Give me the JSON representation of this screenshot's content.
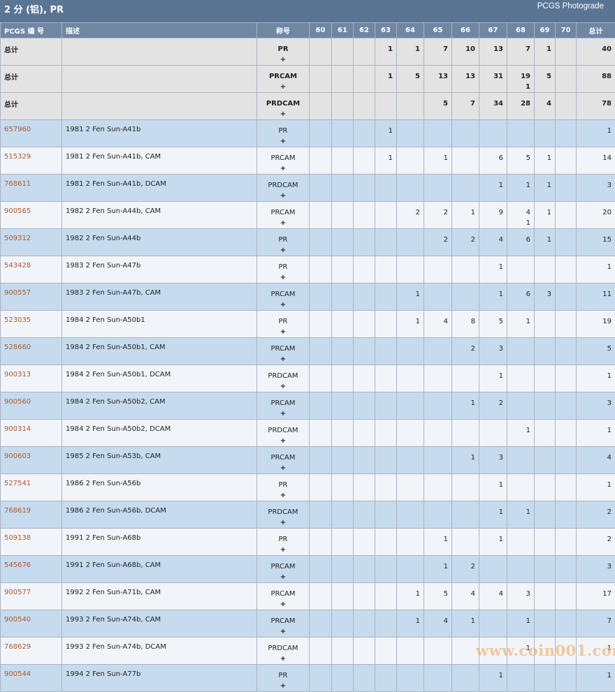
{
  "title": "2 分 (铝), PR",
  "brand": "PCGS Photograde",
  "headers": [
    "PCGS 编 号",
    "描述",
    "称号",
    "60",
    "61",
    "62",
    "63",
    "64",
    "65",
    "66",
    "67",
    "68",
    "69",
    "70",
    "总计"
  ],
  "rows": [
    {
      "type": "total",
      "id": "总计",
      "desc": "",
      "grade": [
        "PR",
        "+"
      ],
      "counts": [
        "",
        "",
        "",
        "1",
        "1",
        "7",
        "10",
        "13",
        "7",
        "1",
        "",
        "40"
      ]
    },
    {
      "type": "total",
      "id": "总计",
      "desc": "",
      "grade": [
        "PRCAM",
        "+"
      ],
      "counts": [
        "",
        "",
        "",
        "1",
        "5",
        "13",
        "13",
        "31",
        "19\n1",
        "5",
        "",
        "88"
      ]
    },
    {
      "type": "total",
      "id": "总计",
      "desc": "",
      "grade": [
        "PRDCAM",
        "+"
      ],
      "counts": [
        "",
        "",
        "",
        "",
        "",
        "5",
        "7",
        "34",
        "28",
        "4",
        "",
        "78"
      ]
    },
    {
      "type": "item",
      "id": "657960",
      "desc": "1981 2 Fen Sun-A41b",
      "grade": [
        "PR",
        "+"
      ],
      "counts": [
        "",
        "",
        "",
        "1",
        "",
        "",
        "",
        "",
        "",
        "",
        "",
        "1"
      ]
    },
    {
      "type": "item",
      "id": "515329",
      "desc": "1981 2 Fen Sun-A41b, CAM",
      "grade": [
        "PRCAM",
        "+"
      ],
      "counts": [
        "",
        "",
        "",
        "1",
        "",
        "1",
        "",
        "6",
        "5",
        "1",
        "",
        "14"
      ]
    },
    {
      "type": "item",
      "id": "768611",
      "desc": "1981 2 Fen Sun-A41b, DCAM",
      "grade": [
        "PRDCAM",
        "+"
      ],
      "counts": [
        "",
        "",
        "",
        "",
        "",
        "",
        "",
        "1",
        "1",
        "1",
        "",
        "3"
      ]
    },
    {
      "type": "item",
      "id": "900565",
      "desc": "1982 2 Fen Sun-A44b, CAM",
      "grade": [
        "PRCAM",
        "+"
      ],
      "counts": [
        "",
        "",
        "",
        "",
        "2",
        "2",
        "1",
        "9",
        "4\n1",
        "1",
        "",
        "20"
      ]
    },
    {
      "type": "item",
      "id": "509312",
      "desc": "1982 2 Fen Sun-A44b",
      "grade": [
        "PR",
        "+"
      ],
      "counts": [
        "",
        "",
        "",
        "",
        "",
        "2",
        "2",
        "4",
        "6",
        "1",
        "",
        "15"
      ]
    },
    {
      "type": "item",
      "id": "543428",
      "desc": "1983 2 Fen Sun-A47b",
      "grade": [
        "PR",
        "+"
      ],
      "counts": [
        "",
        "",
        "",
        "",
        "",
        "",
        "",
        "1",
        "",
        "",
        "",
        "1"
      ]
    },
    {
      "type": "item",
      "id": "900557",
      "desc": "1983 2 Fen Sun-A47b, CAM",
      "grade": [
        "PRCAM",
        "+"
      ],
      "counts": [
        "",
        "",
        "",
        "",
        "1",
        "",
        "",
        "1",
        "6",
        "3",
        "",
        "11"
      ]
    },
    {
      "type": "item",
      "id": "523035",
      "desc": "1984 2 Fen Sun-A50b1",
      "grade": [
        "PR",
        "+"
      ],
      "counts": [
        "",
        "",
        "",
        "",
        "1",
        "4",
        "8",
        "5",
        "1",
        "",
        "",
        "19"
      ]
    },
    {
      "type": "item",
      "id": "528660",
      "desc": "1984 2 Fen Sun-A50b1, CAM",
      "grade": [
        "PRCAM",
        "+"
      ],
      "counts": [
        "",
        "",
        "",
        "",
        "",
        "",
        "2",
        "3",
        "",
        "",
        "",
        "5"
      ]
    },
    {
      "type": "item",
      "id": "900313",
      "desc": "1984 2 Fen Sun-A50b1, DCAM",
      "grade": [
        "PRDCAM",
        "+"
      ],
      "counts": [
        "",
        "",
        "",
        "",
        "",
        "",
        "",
        "1",
        "",
        "",
        "",
        "1"
      ]
    },
    {
      "type": "item",
      "id": "900560",
      "desc": "1984 2 Fen Sun-A50b2, CAM",
      "grade": [
        "PRCAM",
        "+"
      ],
      "counts": [
        "",
        "",
        "",
        "",
        "",
        "",
        "1",
        "2",
        "",
        "",
        "",
        "3"
      ]
    },
    {
      "type": "item",
      "id": "900314",
      "desc": "1984 2 Fen Sun-A50b2, DCAM",
      "grade": [
        "PRDCAM",
        "+"
      ],
      "counts": [
        "",
        "",
        "",
        "",
        "",
        "",
        "",
        "",
        "1",
        "",
        "",
        "1"
      ]
    },
    {
      "type": "item",
      "id": "900603",
      "desc": "1985 2 Fen Sun-A53b, CAM",
      "grade": [
        "PRCAM",
        "+"
      ],
      "counts": [
        "",
        "",
        "",
        "",
        "",
        "",
        "1",
        "3",
        "",
        "",
        "",
        "4"
      ]
    },
    {
      "type": "item",
      "id": "527541",
      "desc": "1986 2 Fen Sun-A56b",
      "grade": [
        "PR",
        "+"
      ],
      "counts": [
        "",
        "",
        "",
        "",
        "",
        "",
        "",
        "1",
        "",
        "",
        "",
        "1"
      ]
    },
    {
      "type": "item",
      "id": "768619",
      "desc": "1986 2 Fen Sun-A56b, DCAM",
      "grade": [
        "PRDCAM",
        "+"
      ],
      "counts": [
        "",
        "",
        "",
        "",
        "",
        "",
        "",
        "1",
        "1",
        "",
        "",
        "2"
      ]
    },
    {
      "type": "item",
      "id": "509138",
      "desc": "1991 2 Fen Sun-A68b",
      "grade": [
        "PR",
        "+"
      ],
      "counts": [
        "",
        "",
        "",
        "",
        "",
        "1",
        "",
        "1",
        "",
        "",
        "",
        "2"
      ]
    },
    {
      "type": "item",
      "id": "545676",
      "desc": "1991 2 Fen Sun-A68b, CAM",
      "grade": [
        "PRCAM",
        "+"
      ],
      "counts": [
        "",
        "",
        "",
        "",
        "",
        "1",
        "2",
        "",
        "",
        "",
        "",
        "3"
      ]
    },
    {
      "type": "item",
      "id": "900577",
      "desc": "1992 2 Fen Sun-A71b, CAM",
      "grade": [
        "PRCAM",
        "+"
      ],
      "counts": [
        "",
        "",
        "",
        "",
        "1",
        "5",
        "4",
        "4",
        "3",
        "",
        "",
        "17"
      ]
    },
    {
      "type": "item",
      "id": "900540",
      "desc": "1993 2 Fen Sun-A74b, CAM",
      "grade": [
        "PRCAM",
        "+"
      ],
      "counts": [
        "",
        "",
        "",
        "",
        "1",
        "4",
        "1",
        "",
        "1",
        "",
        "",
        "7"
      ]
    },
    {
      "type": "item",
      "id": "768629",
      "desc": "1993 2 Fen Sun-A74b, DCAM",
      "grade": [
        "PRDCAM",
        "+"
      ],
      "counts": [
        "",
        "",
        "",
        "",
        "",
        "",
        "",
        "",
        "1",
        "",
        "",
        "1"
      ]
    },
    {
      "type": "item",
      "id": "900544",
      "desc": "1994 2 Fen Sun-A77b",
      "grade": [
        "PR",
        "+"
      ],
      "counts": [
        "",
        "",
        "",
        "",
        "",
        "",
        "",
        "1",
        "",
        "",
        "",
        "1"
      ]
    }
  ],
  "watermark": "www.coin001.com"
}
